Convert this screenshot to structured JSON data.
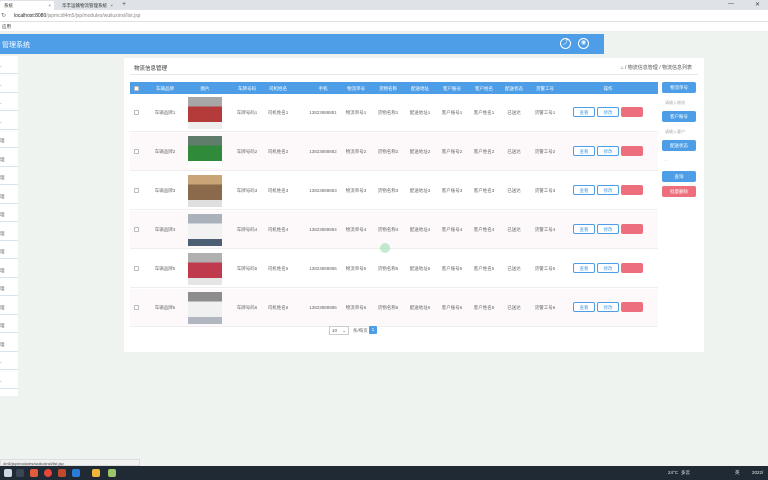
{
  "browser": {
    "tabs": [
      {
        "label": "系统"
      },
      {
        "label": "华丰运输物流管理系统"
      }
    ],
    "new_tab": "+",
    "url_host": "localhost:8080",
    "url_path": "/jspmcdl4m5/jsp/modules/wuliuxinxi/list.jsp",
    "bookmark": "应用",
    "nav_back": "←",
    "nav_forward": "→",
    "nav_reload": "↻",
    "win_min": "—",
    "win_close": "✕"
  },
  "app": {
    "title": "管理系统",
    "icons": [
      "share-icon",
      "user-icon"
    ]
  },
  "sidebar": {
    "items": [
      {
        "label": "-"
      },
      {
        "label": "-"
      },
      {
        "label": "-"
      },
      {
        "label": "-"
      },
      {
        "label": "理"
      },
      {
        "label": "理"
      },
      {
        "label": "理"
      },
      {
        "label": "理"
      },
      {
        "label": "理"
      },
      {
        "label": "理"
      },
      {
        "label": "理"
      },
      {
        "label": "理"
      },
      {
        "label": "理"
      },
      {
        "label": "理"
      },
      {
        "label": "理"
      },
      {
        "label": "理"
      },
      {
        "label": "-"
      },
      {
        "label": "-"
      }
    ]
  },
  "page": {
    "title": "物流信息管理",
    "breadcrumb": [
      "⌂",
      "物流信息管理",
      "物流信息列表"
    ],
    "breadcrumb_sep": "/"
  },
  "table": {
    "columns": [
      "车辆品牌",
      "图片",
      "车牌号码",
      "司机姓名",
      "手机",
      "物流单号",
      "货物名称",
      "配送地址",
      "客户账号",
      "客户姓名",
      "配送状态",
      "货警工号",
      "操作"
    ],
    "rows": [
      {
        "brand": "车辆品牌1",
        "plate": "车牌号码1",
        "driver": "司机姓名1",
        "phone": "13823888881",
        "order": "物流单号1",
        "goods": "货物名称1",
        "addr": "配送地址1",
        "account": "客户账号1",
        "customer": "客户姓名1",
        "status": "已送达",
        "staff": "货警工号1"
      },
      {
        "brand": "车辆品牌2",
        "plate": "车牌号码2",
        "driver": "司机姓名2",
        "phone": "13823888882",
        "order": "物流单号2",
        "goods": "货物名称2",
        "addr": "配送地址2",
        "account": "客户账号2",
        "customer": "客户姓名2",
        "status": "已送达",
        "staff": "货警工号2"
      },
      {
        "brand": "车辆品牌3",
        "plate": "车牌号码3",
        "driver": "司机姓名3",
        "phone": "13823888883",
        "order": "物流单号3",
        "goods": "货物名称3",
        "addr": "配送地址3",
        "account": "客户账号3",
        "customer": "客户姓名3",
        "status": "已送达",
        "staff": "货警工号3"
      },
      {
        "brand": "车辆品牌4",
        "plate": "车牌号码4",
        "driver": "司机姓名4",
        "phone": "13823888884",
        "order": "物流单号4",
        "goods": "货物名称4",
        "addr": "配送地址4",
        "account": "客户账号4",
        "customer": "客户姓名4",
        "status": "已送达",
        "staff": "货警工号4"
      },
      {
        "brand": "车辆品牌5",
        "plate": "车牌号码5",
        "driver": "司机姓名5",
        "phone": "13823888885",
        "order": "物流单号5",
        "goods": "货物名称5",
        "addr": "配送地址5",
        "account": "客户账号5",
        "customer": "客户姓名5",
        "status": "已送达",
        "staff": "货警工号5"
      },
      {
        "brand": "车辆品牌6",
        "plate": "车牌号码6",
        "driver": "司机姓名6",
        "phone": "13823888886",
        "order": "物流单号6",
        "goods": "货物名称6",
        "addr": "配送地址6",
        "account": "客户账号6",
        "customer": "客户姓名6",
        "status": "已送达",
        "staff": "货警工号6"
      }
    ],
    "view_label": "查看",
    "edit_label": "修改",
    "delete_label": "删除"
  },
  "search": {
    "order_btn": "物流单号",
    "order_placeholder": "请输入物流",
    "account_btn": "客户账号",
    "customer_placeholder": "请输入客户",
    "status_btn": "配送状态",
    "status_value": "-",
    "query_btn": "查询",
    "batch_delete_btn": "批量删除"
  },
  "pager": {
    "page_size": "10",
    "page_size_arrow": "⌄",
    "per_page_label": "条/每页",
    "current_page": "1"
  },
  "statusbar": {
    "text": "4m5/jsp/modules/wuliuxinxi/list.jsp"
  },
  "taskbar": {
    "temperature": "24°C",
    "weather": "多云",
    "time": "2022/",
    "ime": "英"
  },
  "colors": {
    "accent": "#4d9ee6",
    "danger": "#ed6f7d",
    "page_bg": "#eef3ef"
  }
}
